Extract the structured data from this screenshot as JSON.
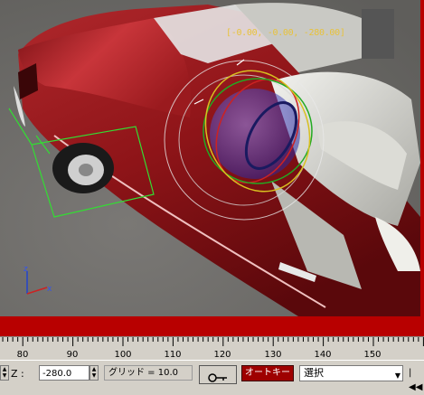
{
  "viewport": {
    "coord_readout": "[-0.00, -0.00, -280.00]",
    "axis_tripod": {
      "z_label": "z",
      "x_label": "x"
    }
  },
  "timeline": {
    "ticks": [
      "80",
      "90",
      "100",
      "110",
      "120",
      "130",
      "140",
      "150"
    ]
  },
  "statusbar": {
    "z_label": "Z :",
    "z_value": "-280.0",
    "grid_label": "グリッド = 10.0",
    "autokey_label": "オートキー",
    "selection_value": "選択",
    "dropdown_arrow": "▼",
    "prev_frame_icon": "|◀◀"
  },
  "colors": {
    "car_body": "#8e1418",
    "viewport_border": "#b80000",
    "gizmo_x": "#cc2222",
    "gizmo_y": "#22aa22",
    "gizmo_z": "#2244cc",
    "autokey_active": "#9e0000"
  }
}
